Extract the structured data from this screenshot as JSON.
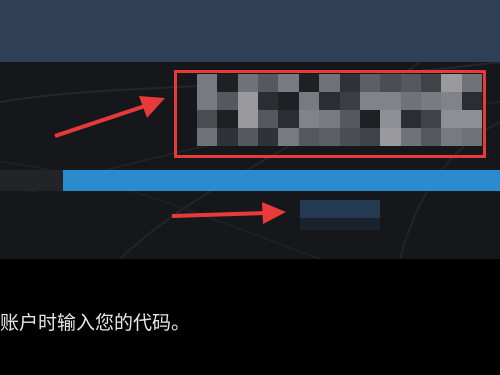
{
  "colors": {
    "header": "#2f3f56",
    "panel": "#15171b",
    "progress_fill": "#2a8ccc",
    "highlight": "#e83a3a",
    "arrow": "#e83a3a"
  },
  "progress": {
    "fraction": 0.874
  },
  "code_display": {
    "state": "pixelated",
    "icon": "pixelated-code-icon"
  },
  "instruction": {
    "text": "账户时输入您的代码。"
  }
}
